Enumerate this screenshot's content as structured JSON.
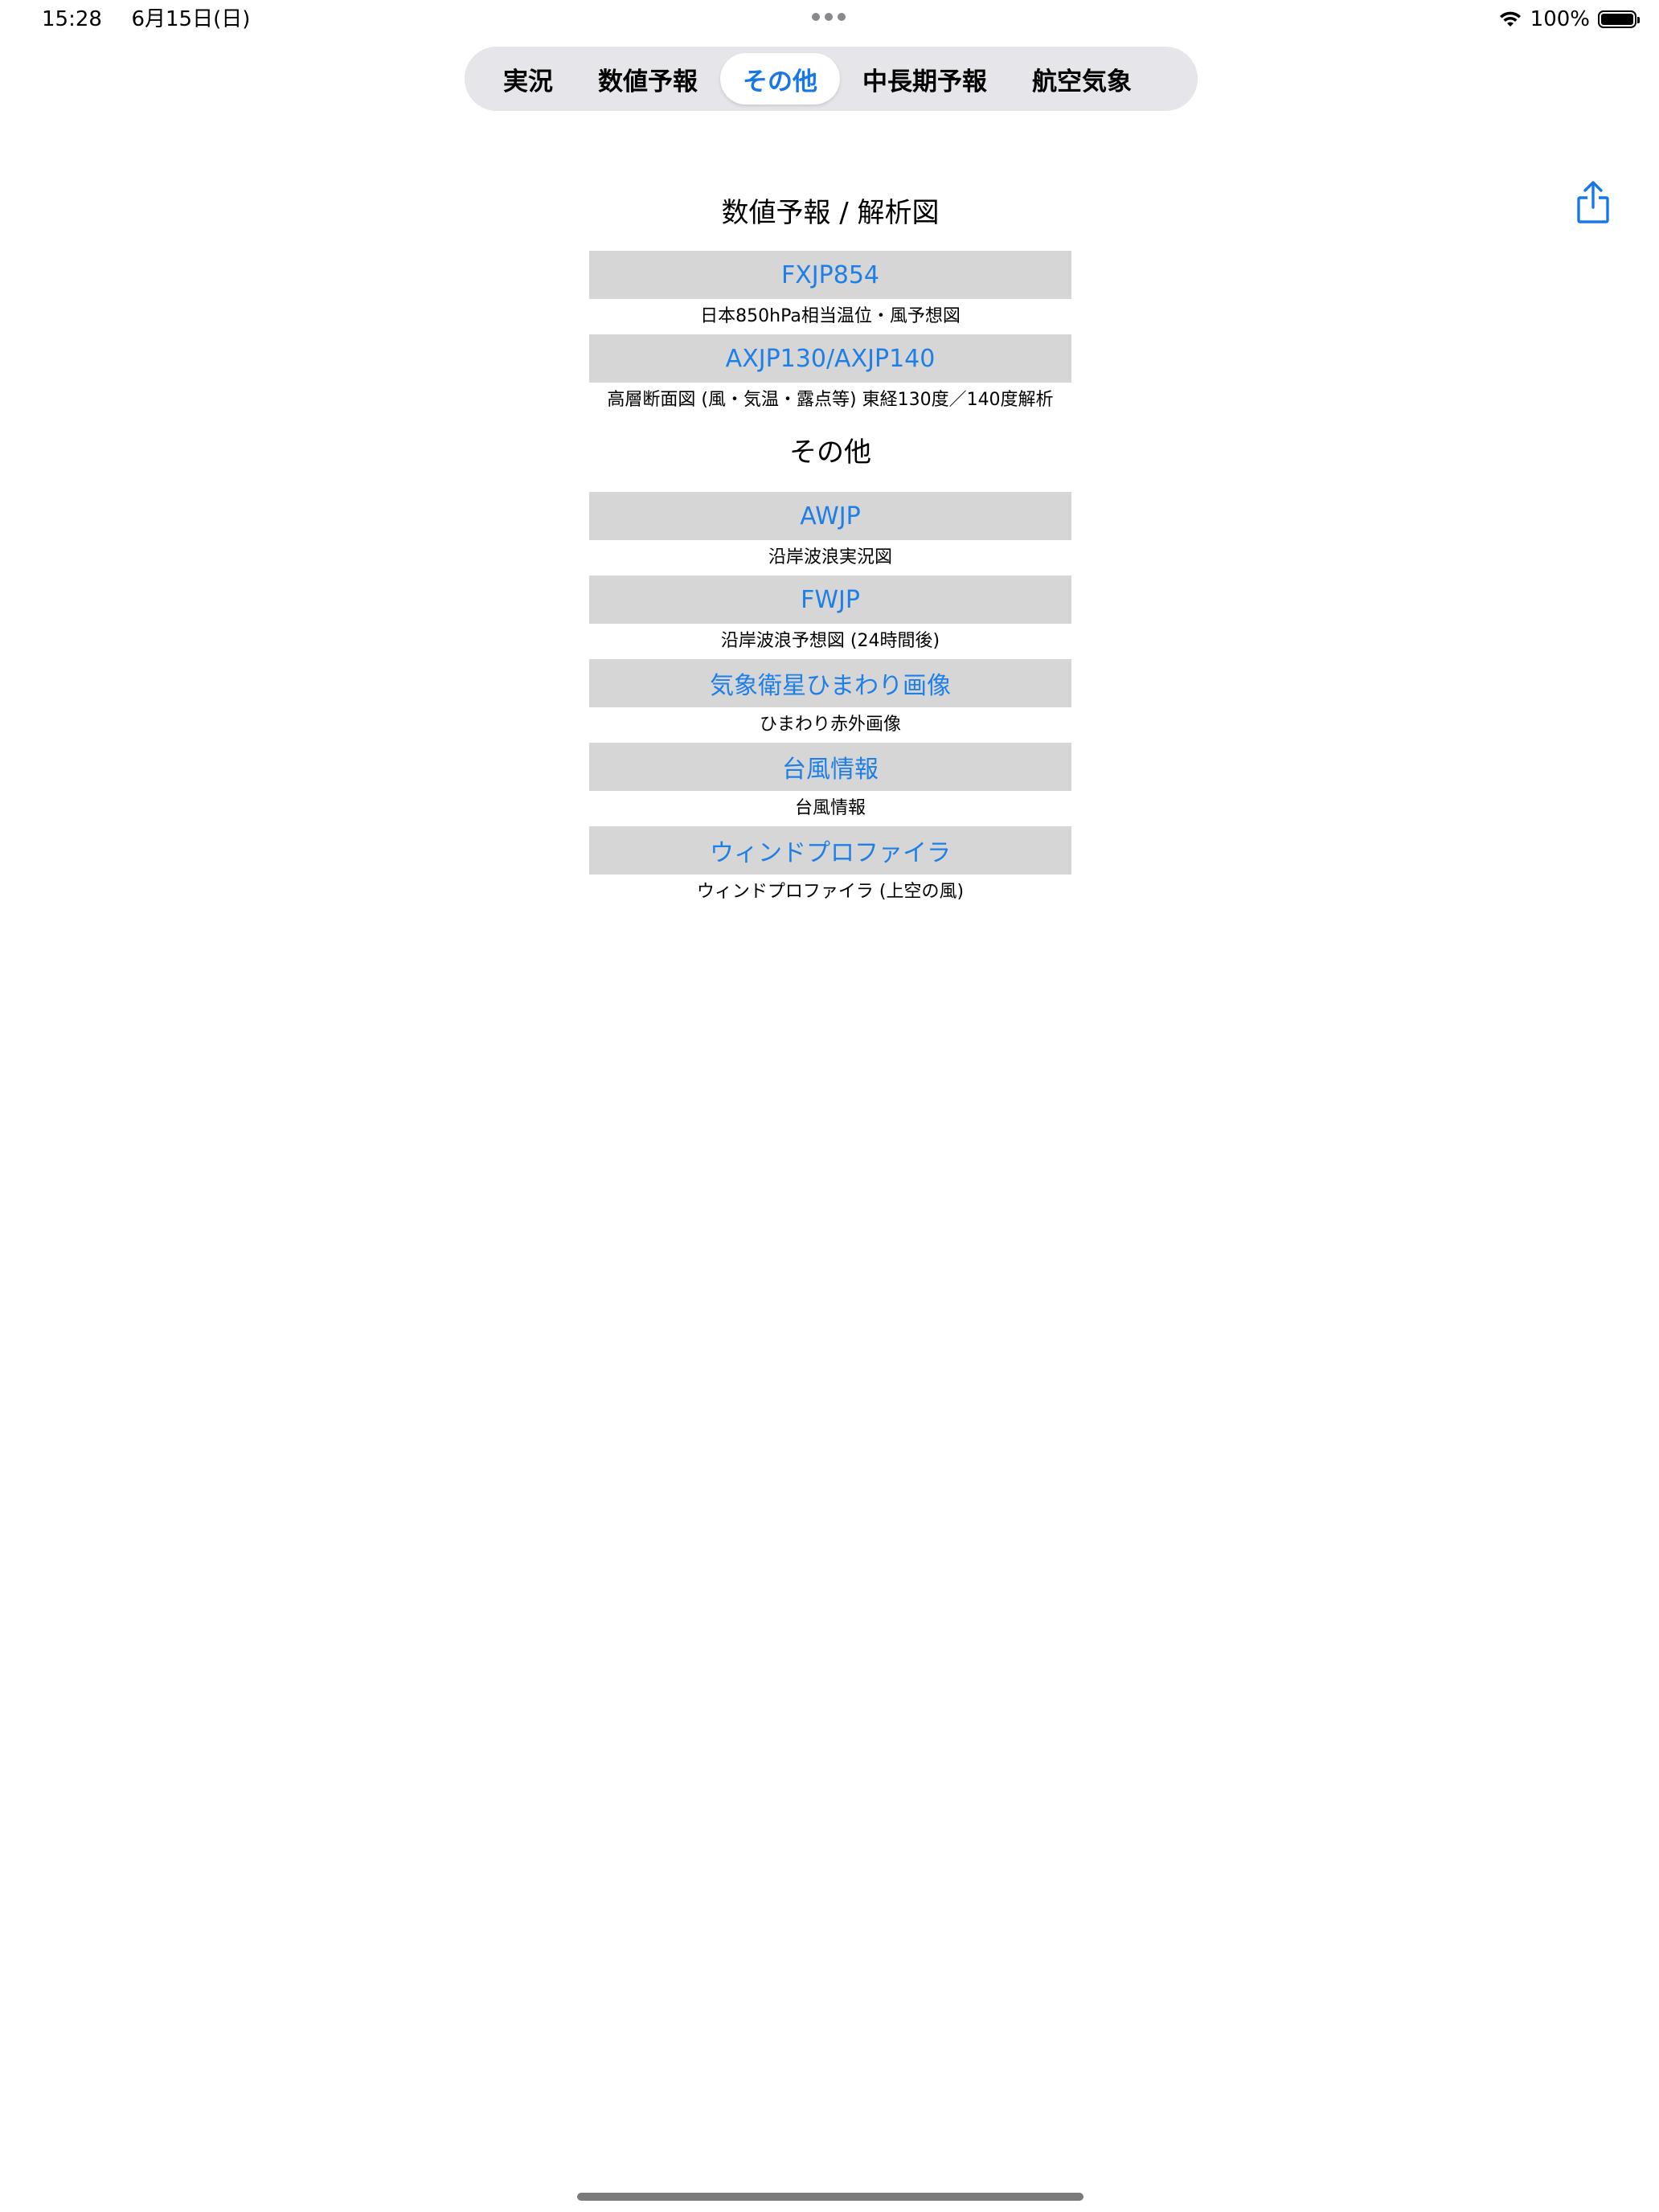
{
  "status_bar": {
    "time": "15:28",
    "date": "6月15日(日)",
    "battery": "100%"
  },
  "tabs": [
    {
      "label": "実況",
      "active": false
    },
    {
      "label": "数値予報",
      "active": false
    },
    {
      "label": "その他",
      "active": true
    },
    {
      "label": "中長期予報",
      "active": false
    },
    {
      "label": "航空気象",
      "active": false
    }
  ],
  "sections": [
    {
      "title": "数値予報 / 解析図",
      "items": [
        {
          "label": "FXJP854",
          "desc": "日本850hPa相当温位・風予想図"
        },
        {
          "label": "AXJP130/AXJP140",
          "desc": "高層断面図 (風・気温・露点等) 東経130度／140度解析"
        }
      ]
    },
    {
      "title": "その他",
      "items": [
        {
          "label": "AWJP",
          "desc": "沿岸波浪実況図"
        },
        {
          "label": "FWJP",
          "desc": "沿岸波浪予想図 (24時間後)"
        },
        {
          "label": "気象衛星ひまわり画像",
          "desc": "ひまわり赤外画像"
        },
        {
          "label": "台風情報",
          "desc": "台風情報"
        },
        {
          "label": "ウィンドプロファイラ",
          "desc": "ウィンドプロファイラ (上空の風)"
        }
      ]
    }
  ],
  "icons": {
    "share": "share-icon",
    "wifi": "wifi-icon",
    "battery": "battery-icon",
    "multitask": "multitask-dots-icon"
  },
  "colors": {
    "accent": "#1877e6",
    "button_bg": "#d6d6d6",
    "segment_bg": "#e5e5ea"
  }
}
